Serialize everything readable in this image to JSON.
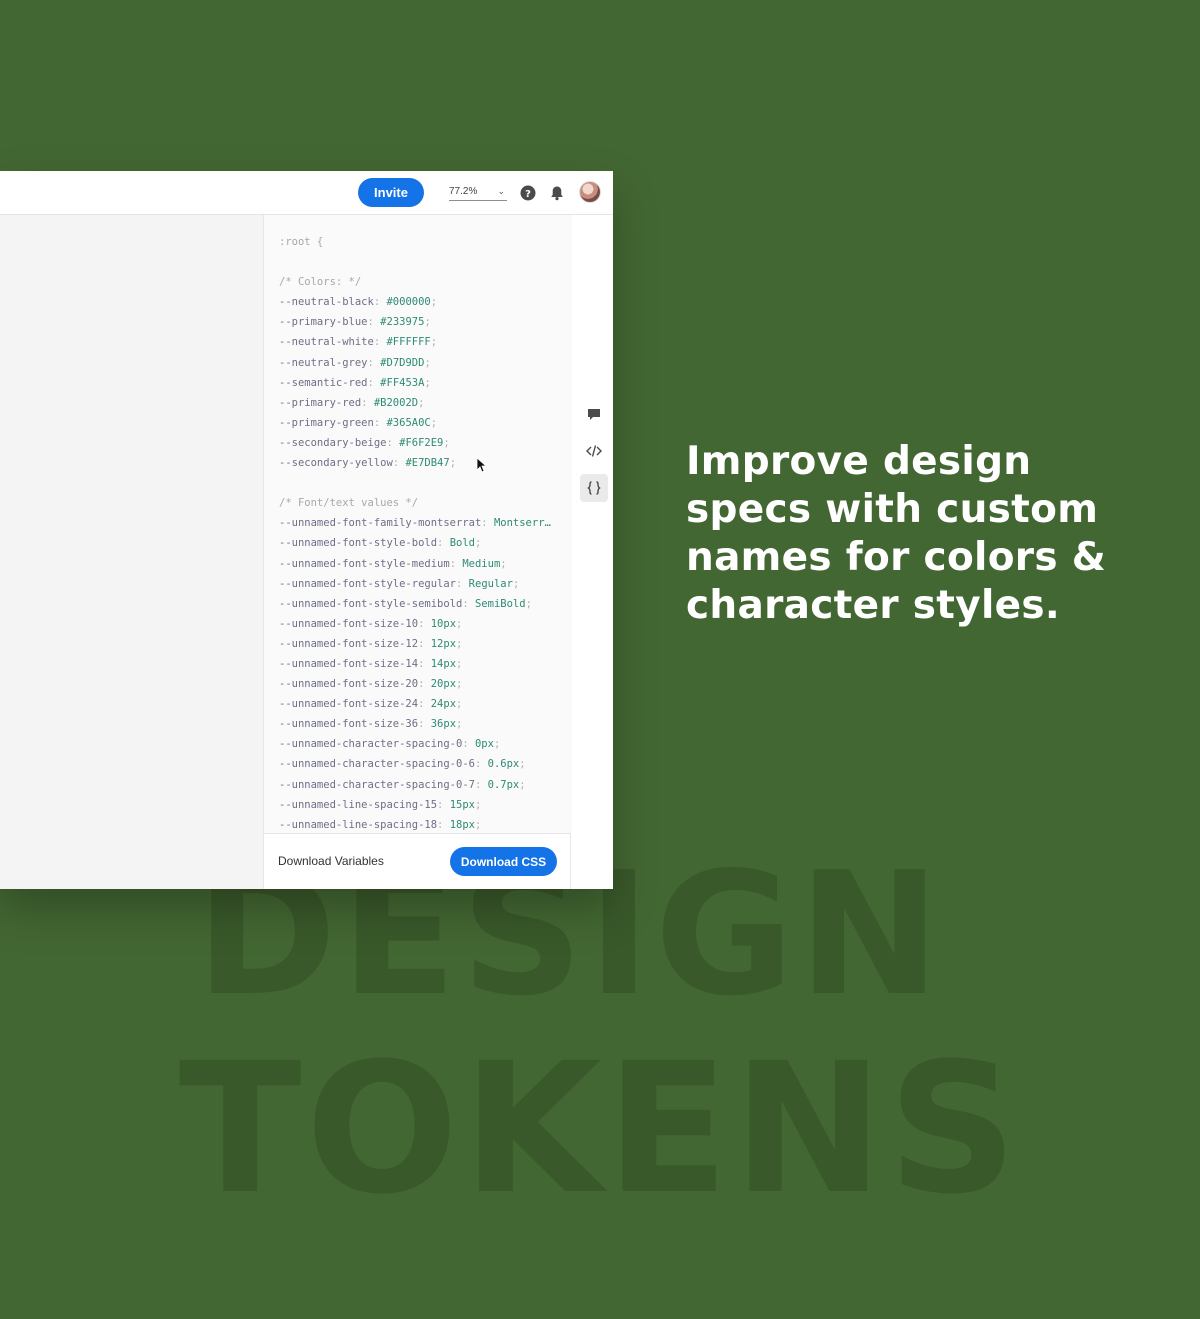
{
  "theme": {
    "background": "#436732",
    "accent": "#1473e6"
  },
  "background_words": [
    "DESIGN",
    "TOKENS"
  ],
  "headline": "Improve design specs with custom names for colors & character styles.",
  "topbar": {
    "invite_label": "Invite",
    "zoom_value": "77.2%",
    "icons": [
      "help-icon",
      "bell-icon",
      "avatar"
    ]
  },
  "rail": {
    "icons": [
      "comment-icon",
      "code-icon",
      "variables-icon",
      "flag-icon"
    ]
  },
  "code": {
    "root_open": ":root {",
    "colors_comment": "/* Colors: */",
    "colors": [
      {
        "name": "--neutral-black",
        "value": "#000000"
      },
      {
        "name": "--primary-blue",
        "value": "#233975"
      },
      {
        "name": "--neutral-white",
        "value": "#FFFFFF"
      },
      {
        "name": "--neutral-grey",
        "value": "#D7D9DD"
      },
      {
        "name": "--semantic-red",
        "value": "#FF453A"
      },
      {
        "name": "--primary-red",
        "value": "#B2002D"
      },
      {
        "name": "--primary-green",
        "value": "#365A0C"
      },
      {
        "name": "--secondary-beige",
        "value": "#F6F2E9"
      },
      {
        "name": "--secondary-yellow",
        "value": "#E7DB47"
      }
    ],
    "font_comment": "/* Font/text values */",
    "fonts": [
      {
        "name": "--unnamed-font-family-montserrat",
        "value": "Montserr…"
      },
      {
        "name": "--unnamed-font-style-bold",
        "value": "Bold"
      },
      {
        "name": "--unnamed-font-style-medium",
        "value": "Medium"
      },
      {
        "name": "--unnamed-font-style-regular",
        "value": "Regular"
      },
      {
        "name": "--unnamed-font-style-semibold",
        "value": "SemiBold"
      },
      {
        "name": "--unnamed-font-size-10",
        "value": "10px"
      },
      {
        "name": "--unnamed-font-size-12",
        "value": "12px"
      },
      {
        "name": "--unnamed-font-size-14",
        "value": "14px"
      },
      {
        "name": "--unnamed-font-size-20",
        "value": "20px"
      },
      {
        "name": "--unnamed-font-size-24",
        "value": "24px"
      },
      {
        "name": "--unnamed-font-size-36",
        "value": "36px"
      },
      {
        "name": "--unnamed-character-spacing-0",
        "value": "0px"
      },
      {
        "name": "--unnamed-character-spacing-0-6",
        "value": "0.6px"
      },
      {
        "name": "--unnamed-character-spacing-0-7",
        "value": "0.7px"
      },
      {
        "name": "--unnamed-line-spacing-15",
        "value": "15px"
      },
      {
        "name": "--unnamed-line-spacing-18",
        "value": "18px"
      }
    ]
  },
  "footer": {
    "download_variables_label": "Download Variables",
    "download_css_label": "Download CSS"
  }
}
